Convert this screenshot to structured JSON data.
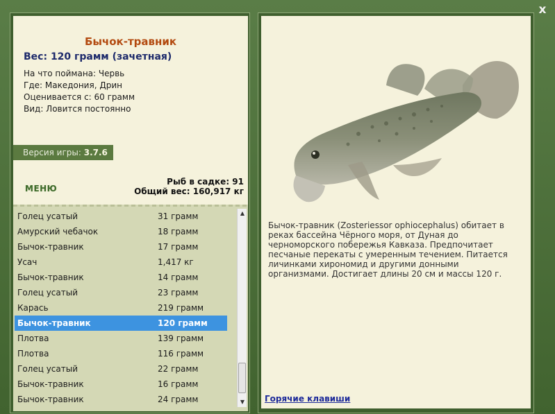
{
  "window": {
    "close_label": "x"
  },
  "fish": {
    "title": "Бычок-травник",
    "weight_line": "Вес: 120 грамм (зачетная)",
    "caught_on": "На что поймана: Червь",
    "location": "Где: Македония, Дрин",
    "rated_from": "Оценивается с: 60 грамм",
    "kind": "Вид: Ловится постоянно",
    "description": "Бычок-травник (Zosteriessor ophiocephalus) обитает в реках бассейна Чёрного моря, от Дуная до черноморского побережья Кавказа. Предпочитает песчаные перекаты с умеренным течением. Питается личинками хирономид и другими донными организмами. Достигает длины 20 см и массы 120 г."
  },
  "version": {
    "label": "Версия игры:",
    "value": "3.7.6"
  },
  "menu": {
    "label": "МЕНЮ"
  },
  "stats": {
    "fish_in_keepnet": "Рыб в садке: 91",
    "total_weight": "Общий вес: 160,917 кг"
  },
  "catch_list": [
    {
      "name": "Голец усатый",
      "weight": "31 грамм"
    },
    {
      "name": "Амурский чебачок",
      "weight": "18 грамм"
    },
    {
      "name": "Бычок-травник",
      "weight": "17 грамм"
    },
    {
      "name": "Усач",
      "weight": "1,417 кг"
    },
    {
      "name": "Бычок-травник",
      "weight": "14 грамм"
    },
    {
      "name": "Голец усатый",
      "weight": "23 грамм"
    },
    {
      "name": "Карась",
      "weight": "219 грамм"
    },
    {
      "name": "Бычок-травник",
      "weight": "120 грамм",
      "selected": true
    },
    {
      "name": "Плотва",
      "weight": "139 грамм"
    },
    {
      "name": "Плотва",
      "weight": "116 грамм"
    },
    {
      "name": "Голец усатый",
      "weight": "22 грамм"
    },
    {
      "name": "Бычок-травник",
      "weight": "16 грамм"
    },
    {
      "name": "Бычок-травник",
      "weight": "24 грамм"
    }
  ],
  "hotkeys": {
    "label": "Горячие клавиши"
  },
  "icons": {
    "close": "close-icon",
    "scroll_up": "arrow-up-icon",
    "scroll_down": "arrow-down-icon"
  },
  "colors": {
    "accent": "#3d93e0",
    "title": "#b34a10",
    "weight": "#1d2a6b",
    "frame": "#4a6b3a"
  }
}
